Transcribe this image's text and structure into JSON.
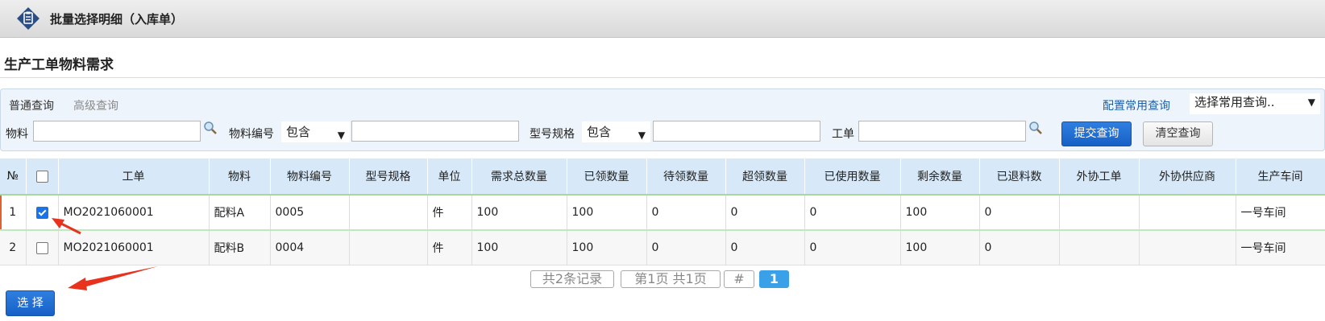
{
  "window": {
    "title": "批量选择明细（入库单）"
  },
  "page": {
    "title": "生产工单物料需求"
  },
  "search": {
    "tabs": [
      "普通查询",
      "高级查询"
    ],
    "configure_link": "配置常用查询",
    "common_query_select": "选择常用查询..",
    "material_label": "物料",
    "material_value": "",
    "material_code_label": "物料编号",
    "material_code_op": "包含",
    "material_code_value": "",
    "model_spec_label": "型号规格",
    "model_spec_op": "包含",
    "model_spec_value": "",
    "work_order_label": "工单",
    "work_order_value": "",
    "submit_label": "提交查询",
    "clear_label": "清空查询"
  },
  "table": {
    "columns": [
      "№",
      "",
      "工单",
      "物料",
      "物料编号",
      "型号规格",
      "单位",
      "需求总数量",
      "已领数量",
      "待领数量",
      "超领数量",
      "已使用数量",
      "剩余数量",
      "已退料数",
      "外协工单",
      "外协供应商",
      "生产车间"
    ],
    "rows": [
      {
        "no": "1",
        "checked": true,
        "work_order": "MO2021060001",
        "material": "配料A",
        "material_code": "0005",
        "model_spec": "",
        "unit": "件",
        "required_qty": "100",
        "received_qty": "100",
        "pending_qty": "0",
        "over_qty": "0",
        "used_qty": "0",
        "remaining_qty": "100",
        "returned_qty": "0",
        "outsourced_order": "",
        "outsourced_supplier": "",
        "workshop": "一号车间"
      },
      {
        "no": "2",
        "checked": false,
        "work_order": "MO2021060001",
        "material": "配料B",
        "material_code": "0004",
        "model_spec": "",
        "unit": "件",
        "required_qty": "100",
        "received_qty": "100",
        "pending_qty": "0",
        "over_qty": "0",
        "used_qty": "0",
        "remaining_qty": "100",
        "returned_qty": "0",
        "outsourced_order": "",
        "outsourced_supplier": "",
        "workshop": "一号车间"
      }
    ]
  },
  "pager": {
    "total": "共2条记录",
    "page_info": "第1页 共1页",
    "jump": "#",
    "current": "1"
  },
  "select_button": "选 择",
  "colors": {
    "primary": "#1760c6",
    "header_bg": "#d7e9f9",
    "annotation_arrow": "#e8321e"
  }
}
